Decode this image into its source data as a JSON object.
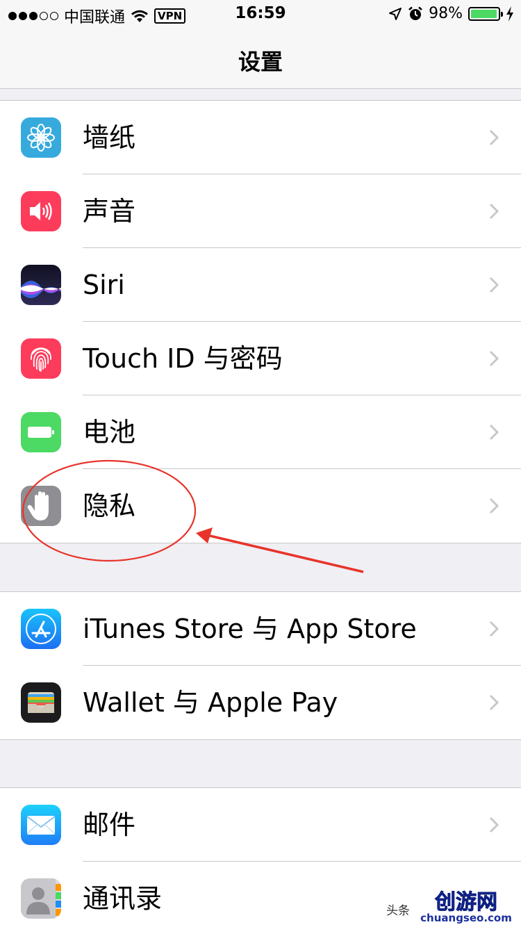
{
  "status": {
    "carrier": "中国联通",
    "vpn": "VPN",
    "time": "16:59",
    "battery": "98%",
    "battery_level": 0.98,
    "signal_bars_filled": 3,
    "signal_bars_total": 5
  },
  "nav": {
    "title": "设置"
  },
  "groups": [
    {
      "items": [
        {
          "label": "墙纸",
          "icon": "wallpaper-icon",
          "color": "#36aadc"
        },
        {
          "label": "声音",
          "icon": "speaker-icon",
          "color": "#fd3c5c"
        },
        {
          "label": "Siri",
          "icon": "siri-icon",
          "color": "#1b1b2e"
        },
        {
          "label": "Touch ID 与密码",
          "icon": "fingerprint-icon",
          "color": "#fd3c5c"
        },
        {
          "label": "电池",
          "icon": "battery-icon",
          "color": "#4cd964"
        },
        {
          "label": "隐私",
          "icon": "hand-icon",
          "color": "#8e8e93"
        }
      ]
    },
    {
      "items": [
        {
          "label": "iTunes Store 与 App Store",
          "icon": "app-store-icon",
          "color": "#1f8ff5"
        },
        {
          "label": "Wallet 与 Apple Pay",
          "icon": "wallet-icon",
          "color": "#1c1c1e"
        }
      ]
    },
    {
      "items": [
        {
          "label": "邮件",
          "icon": "mail-icon",
          "color": "#1f8ff5"
        },
        {
          "label": "通讯录",
          "icon": "contacts-icon",
          "color": "#c8c8cc"
        }
      ]
    }
  ],
  "watermark": {
    "small_text": "头条",
    "brand_text": "创游网",
    "url": "chuangseo.com"
  },
  "colors": {
    "annotation": "#e8332a",
    "separator": "#c8c7cc",
    "chevron": "#c7c7cc"
  }
}
